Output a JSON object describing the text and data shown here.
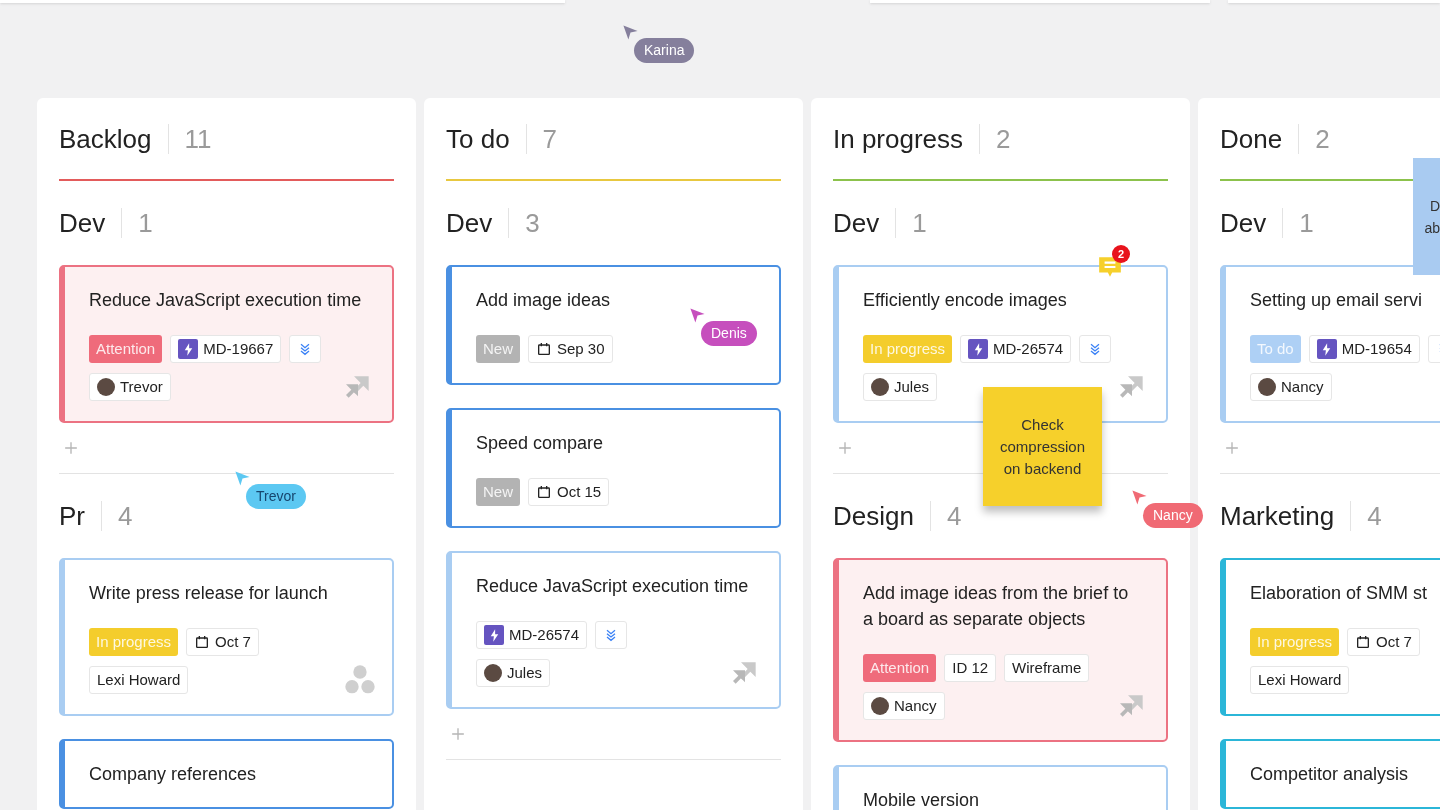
{
  "cursors": [
    {
      "name": "Karina",
      "color": "#857f9c"
    },
    {
      "name": "Denis",
      "color": "#c64fbd"
    },
    {
      "name": "Trevor",
      "color": "#5cc8f2"
    },
    {
      "name": "Nancy",
      "color": "#f06a74"
    }
  ],
  "sticky_notes": [
    {
      "text": "Check compression on backend",
      "color": "#f6d02b"
    },
    {
      "text": "D\nab",
      "color": "#a9cbf1"
    }
  ],
  "columns": [
    {
      "title": "Backlog",
      "count": "11",
      "color": "#e35b5b",
      "lanes": [
        {
          "title": "Dev",
          "count": "1",
          "add_button": true,
          "cards": [
            {
              "title": "Reduce JavaScript execution time",
              "color": "#ec7282",
              "highlighted": true,
              "corner_icon": {
                "kind": "stack"
              },
              "tag_rows": [
                [
                  {
                    "kind": "status",
                    "text": "Attention",
                    "color": "#ef6b7b"
                  },
                  {
                    "kind": "issue",
                    "text": "MD-19667"
                  },
                  {
                    "kind": "priority"
                  }
                ],
                [
                  {
                    "kind": "person",
                    "text": "Trevor",
                    "avatar": true
                  }
                ]
              ]
            }
          ]
        },
        {
          "title": "Pr",
          "count": "4",
          "cards": [
            {
              "title": "Write press release for launch",
              "color": "#a9cdf2",
              "highlighted": false,
              "corner_icon": {
                "kind": "dots"
              },
              "tag_rows": [
                [
                  {
                    "kind": "status",
                    "text": "In progress",
                    "color": "#f4cd2c"
                  },
                  {
                    "kind": "date",
                    "text": "Oct 7"
                  }
                ],
                [
                  {
                    "kind": "person",
                    "text": "Lexi Howard",
                    "avatar": false
                  }
                ]
              ]
            },
            {
              "title": "Company references",
              "color": "#4a90e2",
              "highlighted": false
            }
          ]
        }
      ]
    },
    {
      "title": "To do",
      "count": "7",
      "color": "#e8c840",
      "lanes": [
        {
          "title": "Dev",
          "count": "3",
          "add_button": true,
          "cards": [
            {
              "title": "Add image ideas",
              "color": "#4a90e2",
              "highlighted": false,
              "tag_rows": [
                [
                  {
                    "kind": "status",
                    "text": "New",
                    "color": "#b3b3b3"
                  },
                  {
                    "kind": "date",
                    "text": "Sep 30"
                  }
                ]
              ]
            },
            {
              "title": "Speed compare",
              "color": "#4a90e2",
              "highlighted": false,
              "tag_rows": [
                [
                  {
                    "kind": "status",
                    "text": "New",
                    "color": "#b3b3b3"
                  },
                  {
                    "kind": "date",
                    "text": "Oct 15"
                  }
                ]
              ]
            },
            {
              "title": "Reduce JavaScript execution time",
              "color": "#a9cdf2",
              "highlighted": false,
              "corner_icon": {
                "kind": "stack"
              },
              "tag_rows": [
                [
                  {
                    "kind": "issue",
                    "text": "MD-26574"
                  },
                  {
                    "kind": "priority"
                  }
                ],
                [
                  {
                    "kind": "person",
                    "text": "Jules",
                    "avatar": true
                  }
                ]
              ]
            }
          ]
        }
      ]
    },
    {
      "title": "In progress",
      "count": "2",
      "color": "#8cc24c",
      "lanes": [
        {
          "title": "Dev",
          "count": "1",
          "add_button": true,
          "cards": [
            {
              "title": "Efficiently encode images",
              "color": "#a9cdf2",
              "highlighted": false,
              "corner_icon": {
                "kind": "stack"
              },
              "comments": "2",
              "tag_rows": [
                [
                  {
                    "kind": "status",
                    "text": "In progress",
                    "color": "#f4cd2c"
                  },
                  {
                    "kind": "issue",
                    "text": "MD-26574"
                  },
                  {
                    "kind": "priority"
                  }
                ],
                [
                  {
                    "kind": "person",
                    "text": "Jules",
                    "avatar": true
                  }
                ]
              ]
            }
          ]
        },
        {
          "title": "Design",
          "count": "4",
          "cards": [
            {
              "title": "Add image ideas from the brief to a board as separate objects",
              "color": "#ec7282",
              "highlighted": true,
              "corner_icon": {
                "kind": "stack"
              },
              "tag_rows": [
                [
                  {
                    "kind": "status",
                    "text": "Attention",
                    "color": "#ef6b7b"
                  },
                  {
                    "kind": "label",
                    "text": "ID 12"
                  },
                  {
                    "kind": "label",
                    "text": "Wireframe"
                  }
                ],
                [
                  {
                    "kind": "person",
                    "text": "Nancy",
                    "avatar": true
                  }
                ]
              ]
            },
            {
              "title": "Mobile version",
              "color": "#a9cdf2",
              "highlighted": false
            }
          ]
        }
      ]
    },
    {
      "title": "Done",
      "count": "2",
      "color": "#8cc24c",
      "lanes": [
        {
          "title": "Dev",
          "count": "1",
          "add_button": true,
          "cards": [
            {
              "title": "Setting up email servi",
              "color": "#a9cdf2",
              "highlighted": false,
              "tag_rows": [
                [
                  {
                    "kind": "status",
                    "text": "To do",
                    "color": "#aed0f5"
                  },
                  {
                    "kind": "issue",
                    "text": "MD-19654"
                  },
                  {
                    "kind": "priority"
                  }
                ],
                [
                  {
                    "kind": "person",
                    "text": "Nancy",
                    "avatar": true
                  }
                ]
              ]
            }
          ]
        },
        {
          "title": "Marketing",
          "count": "4",
          "cards": [
            {
              "title": "Elaboration of SMM st",
              "color": "#2bb6d8",
              "highlighted": false,
              "tag_rows": [
                [
                  {
                    "kind": "status",
                    "text": "In progress",
                    "color": "#f4cd2c"
                  },
                  {
                    "kind": "date",
                    "text": "Oct 7"
                  }
                ],
                [
                  {
                    "kind": "person",
                    "text": "Lexi Howard",
                    "avatar": false
                  }
                ]
              ]
            },
            {
              "title": "Competitor analysis",
              "color": "#2bb6d8",
              "highlighted": false
            }
          ]
        }
      ]
    }
  ]
}
